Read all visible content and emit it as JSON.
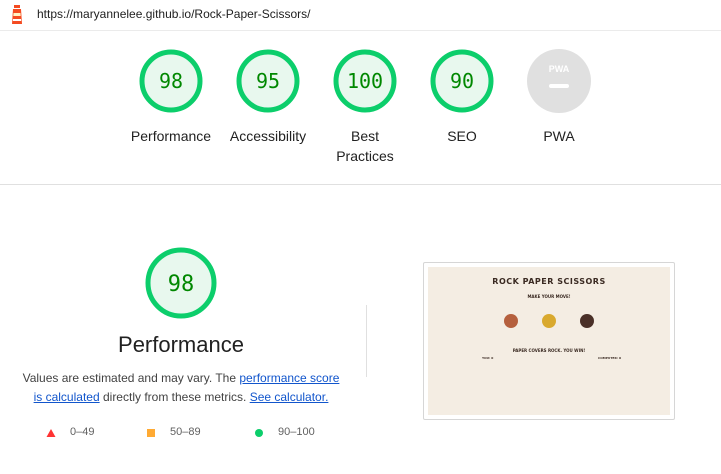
{
  "header": {
    "url": "https://maryannelee.github.io/Rock-Paper-Scissors/",
    "logo_icon": "lighthouse-icon"
  },
  "gauges": [
    {
      "key": "performance",
      "score": "98",
      "label": "Performance"
    },
    {
      "key": "accessibility",
      "score": "95",
      "label": "Accessibility"
    },
    {
      "key": "best-practices",
      "score": "100",
      "label": "Best Practices"
    },
    {
      "key": "seo",
      "score": "90",
      "label": "SEO"
    },
    {
      "key": "pwa",
      "score": "",
      "badge": "PWA",
      "label": "PWA"
    }
  ],
  "performance": {
    "score": "98",
    "title": "Performance",
    "desc_prefix": "Values are estimated and may vary. The ",
    "desc_link1": "performance score is calculated",
    "desc_middle": " directly from these metrics. ",
    "desc_link2": "See calculator."
  },
  "legend": [
    {
      "range": "0–49",
      "icon": "triangle-icon",
      "color": "#ff3333"
    },
    {
      "range": "50–89",
      "icon": "square-icon",
      "color": "#ffaa33"
    },
    {
      "range": "90–100",
      "icon": "circle-icon",
      "color": "#0cce6b"
    }
  ],
  "screenshot": {
    "title": "ROCK PAPER SCISSORS",
    "subtitle": "MAKE YOUR MOVE!",
    "result": "PAPER COVERS ROCK. YOU WIN!",
    "you_label": "YOU: 0",
    "computer_label": "COMPUTER: 0"
  },
  "colors": {
    "pass": "#0cce6b",
    "pass_text": "#008800",
    "pass_fill": "#e8f8ee",
    "pwa_gray": "#e0e0e0"
  }
}
